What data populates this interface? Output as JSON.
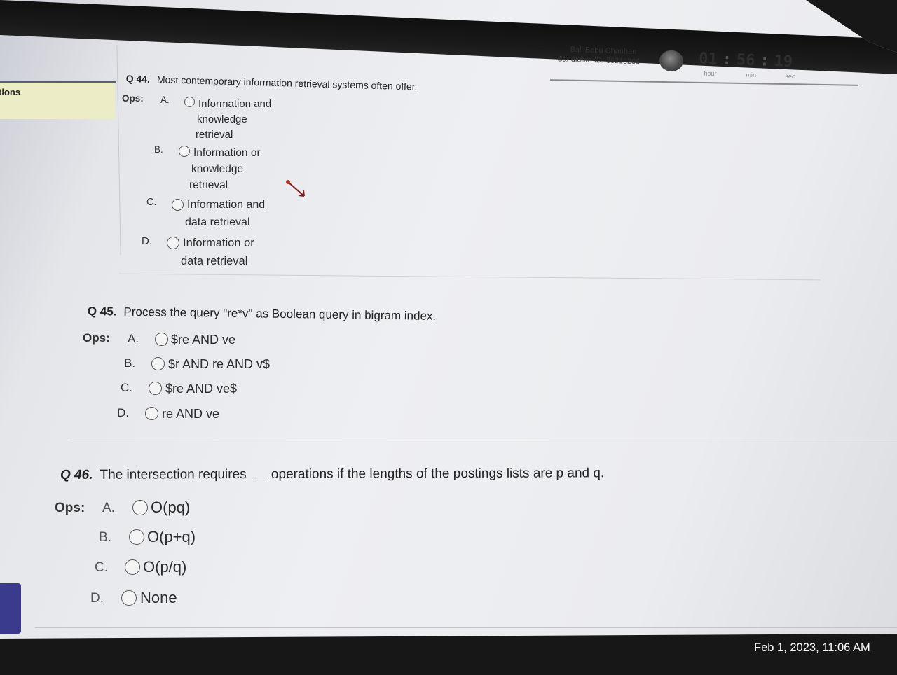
{
  "sidebar": {
    "label": "tions"
  },
  "header": {
    "candidate_name": "Bali Babu Chauhan",
    "candidate_id": "Candidate ID: 36218206",
    "timer": {
      "hour": "01",
      "min": "56",
      "sec": "19",
      "sep": ":"
    },
    "timer_units": {
      "hour": "hour",
      "min": "min",
      "sec": "sec"
    }
  },
  "ops_label": "Ops:",
  "questions": [
    {
      "number": "Q 44.",
      "text": "Most contemporary information retrieval systems often offer.",
      "options": [
        {
          "letter": "A.",
          "lines": [
            "Information and",
            "knowledge",
            "retrieval"
          ]
        },
        {
          "letter": "B.",
          "lines": [
            "Information or",
            "knowledge",
            "retrieval"
          ]
        },
        {
          "letter": "C.",
          "lines": [
            "Information and",
            "data retrieval"
          ]
        },
        {
          "letter": "D.",
          "lines": [
            "Information or",
            "data retrieval"
          ]
        }
      ]
    },
    {
      "number": "Q 45.",
      "text": "Process the query \"re*v\" as Boolean query in bigram index.",
      "options": [
        {
          "letter": "A.",
          "text": "$re AND ve"
        },
        {
          "letter": "B.",
          "text": "$r AND re AND v$"
        },
        {
          "letter": "C.",
          "text": "$re AND ve$"
        },
        {
          "letter": "D.",
          "text": "re AND ve"
        }
      ]
    },
    {
      "number": "Q 46.",
      "text_before": "The intersection requires",
      "text_after": "operations if the lengths of the postings lists are p and q.",
      "options": [
        {
          "letter": "A.",
          "text": "O(pq)"
        },
        {
          "letter": "B.",
          "text": "O(p+q)"
        },
        {
          "letter": "C.",
          "text": "O(p/q)"
        },
        {
          "letter": "D.",
          "text": "None"
        }
      ]
    }
  ],
  "photo_timestamp": "Feb 1, 2023, 11:06 AM"
}
